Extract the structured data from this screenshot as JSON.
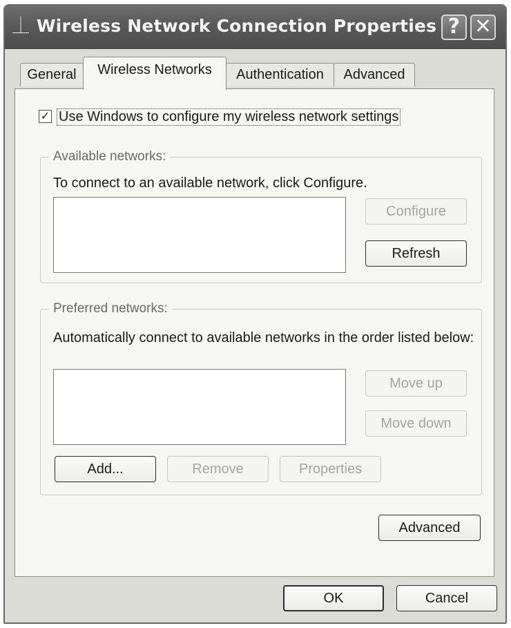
{
  "window": {
    "title": "Wireless Network Connection Properties",
    "help_glyph": "?",
    "close_glyph": "✕",
    "app_icon": "network-plug-icon"
  },
  "tabs": [
    {
      "label": "General",
      "active": false
    },
    {
      "label": "Wireless Networks",
      "active": true
    },
    {
      "label": "Authentication",
      "active": false
    },
    {
      "label": "Advanced",
      "active": false
    }
  ],
  "wireless": {
    "use_windows_label": "Use Windows to configure my wireless network settings",
    "use_windows_checked": true,
    "check_glyph": "✓"
  },
  "available": {
    "legend": "Available networks:",
    "description": "To connect to an available network, click Configure.",
    "configure_label": "Configure",
    "refresh_label": "Refresh"
  },
  "preferred": {
    "legend": "Preferred networks:",
    "description": "Automatically connect to available networks in the order listed below:",
    "move_up_label": "Move up",
    "move_down_label": "Move down",
    "add_label": "Add...",
    "remove_label": "Remove",
    "properties_label": "Properties"
  },
  "advanced_button_label": "Advanced",
  "footer": {
    "ok_label": "OK",
    "cancel_label": "Cancel"
  }
}
